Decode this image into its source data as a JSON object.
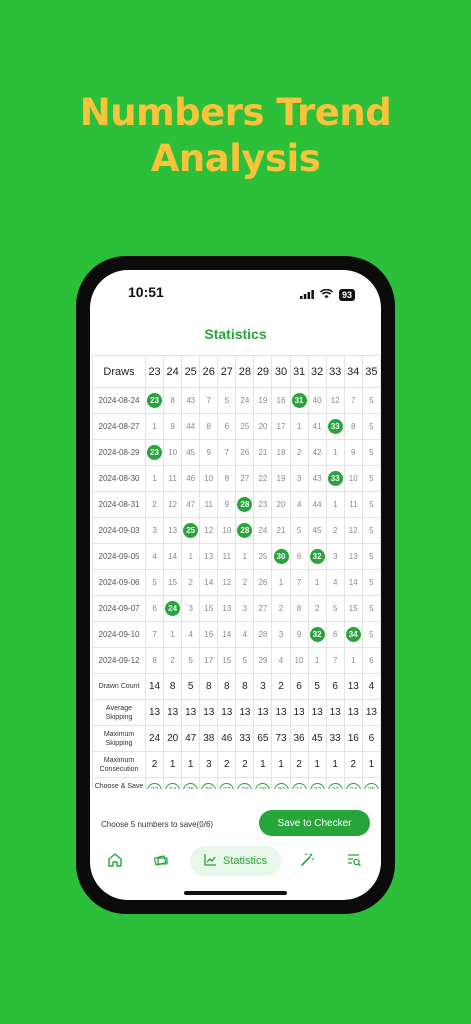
{
  "headline": {
    "line1": "Numbers Trend",
    "line2": "Analysis"
  },
  "status": {
    "time": "10:51",
    "battery": "93"
  },
  "page_title": "Statistics",
  "table": {
    "draws_header": "Draws",
    "numbers": [
      "23",
      "24",
      "25",
      "26",
      "27",
      "28",
      "29",
      "30",
      "31",
      "32",
      "33",
      "34",
      "35"
    ],
    "rows": [
      {
        "date": "2024-08-24",
        "cells": [
          "23",
          "8",
          "43",
          "7",
          "5",
          "24",
          "19",
          "16",
          "31",
          "40",
          "12",
          "7",
          "5"
        ],
        "hits": [
          0,
          8
        ]
      },
      {
        "date": "2024-08-27",
        "cells": [
          "1",
          "9",
          "44",
          "8",
          "6",
          "25",
          "20",
          "17",
          "1",
          "41",
          "33",
          "8",
          "5"
        ],
        "hits": [
          10
        ]
      },
      {
        "date": "2024-08-29",
        "cells": [
          "23",
          "10",
          "45",
          "9",
          "7",
          "26",
          "21",
          "18",
          "2",
          "42",
          "1",
          "9",
          "5"
        ],
        "hits": [
          0
        ]
      },
      {
        "date": "2024-08-30",
        "cells": [
          "1",
          "11",
          "46",
          "10",
          "8",
          "27",
          "22",
          "19",
          "3",
          "43",
          "33",
          "10",
          "5"
        ],
        "hits": [
          10
        ]
      },
      {
        "date": "2024-08-31",
        "cells": [
          "2",
          "12",
          "47",
          "11",
          "9",
          "28",
          "23",
          "20",
          "4",
          "44",
          "1",
          "11",
          "5"
        ],
        "hits": [
          5
        ]
      },
      {
        "date": "2024-09-03",
        "cells": [
          "3",
          "13",
          "25",
          "12",
          "10",
          "28",
          "24",
          "21",
          "5",
          "45",
          "2",
          "12",
          "5"
        ],
        "hits": [
          2,
          5
        ]
      },
      {
        "date": "2024-09-05",
        "cells": [
          "4",
          "14",
          "1",
          "13",
          "11",
          "1",
          "25",
          "30",
          "6",
          "32",
          "3",
          "13",
          "5"
        ],
        "hits": [
          7,
          9
        ]
      },
      {
        "date": "2024-09-06",
        "cells": [
          "5",
          "15",
          "2",
          "14",
          "12",
          "2",
          "26",
          "1",
          "7",
          "1",
          "4",
          "14",
          "5"
        ],
        "hits": []
      },
      {
        "date": "2024-09-07",
        "cells": [
          "6",
          "24",
          "3",
          "15",
          "13",
          "3",
          "27",
          "2",
          "8",
          "2",
          "5",
          "15",
          "5"
        ],
        "hits": [
          1
        ]
      },
      {
        "date": "2024-09-10",
        "cells": [
          "7",
          "1",
          "4",
          "16",
          "14",
          "4",
          "28",
          "3",
          "9",
          "32",
          "6",
          "34",
          "5"
        ],
        "hits": [
          9,
          11
        ]
      },
      {
        "date": "2024-09-12",
        "cells": [
          "8",
          "2",
          "5",
          "17",
          "15",
          "5",
          "29",
          "4",
          "10",
          "1",
          "7",
          "1",
          "6"
        ],
        "hits": []
      }
    ],
    "stats": [
      {
        "label": "Drawn Count",
        "values": [
          "14",
          "8",
          "5",
          "8",
          "8",
          "8",
          "3",
          "2",
          "6",
          "5",
          "6",
          "13",
          "4"
        ]
      },
      {
        "label": "Average Skipping",
        "values": [
          "13",
          "13",
          "13",
          "13",
          "13",
          "13",
          "13",
          "13",
          "13",
          "13",
          "13",
          "13",
          "13"
        ]
      },
      {
        "label": "Maximum Skipping",
        "values": [
          "24",
          "20",
          "47",
          "38",
          "46",
          "33",
          "65",
          "73",
          "36",
          "45",
          "33",
          "16",
          "6"
        ]
      },
      {
        "label": "Maximum Consecution",
        "values": [
          "2",
          "1",
          "1",
          "3",
          "2",
          "2",
          "1",
          "1",
          "2",
          "1",
          "1",
          "2",
          "1"
        ]
      }
    ],
    "choose_label": "Choose & Save Ticket"
  },
  "save": {
    "hint": "Choose 5 numbers to save(0/6)",
    "button": "Save to Checker"
  },
  "tabs": {
    "active_label": "Statistics"
  },
  "colors": {
    "background": "#2cbf3a",
    "accent": "#27a43a",
    "headline": "#f9c43c"
  }
}
